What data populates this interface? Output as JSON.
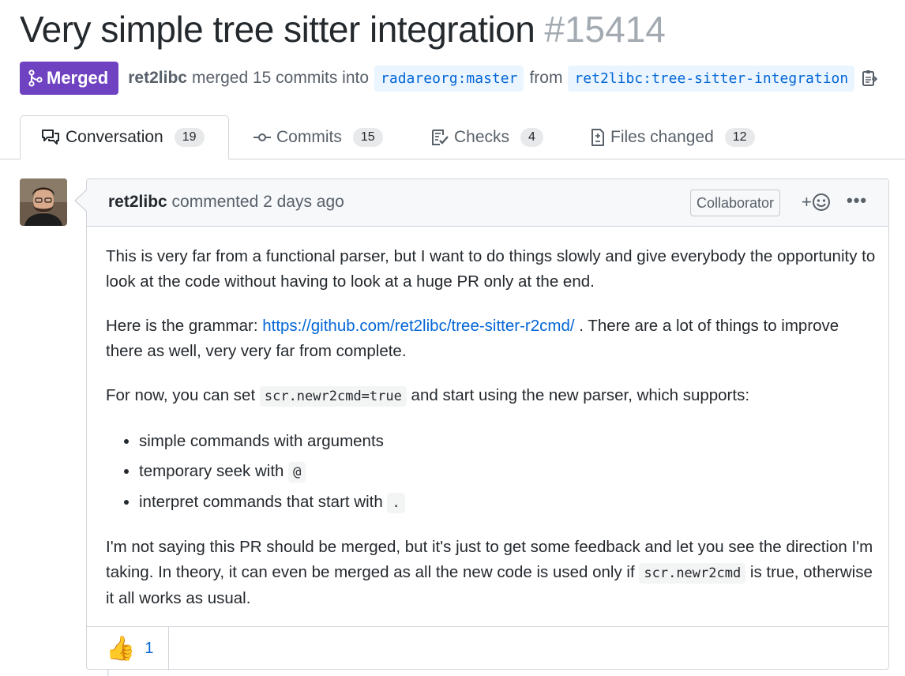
{
  "pr": {
    "title": "Very simple tree sitter integration",
    "number": "#15414",
    "state_label": "Merged",
    "author": "ret2libc",
    "merged_text": "merged 15 commits into",
    "base_branch": "radareorg:master",
    "from_text": "from",
    "head_branch": "ret2libc:tree-sitter-integration"
  },
  "tabs": [
    {
      "label": "Conversation",
      "count": "19",
      "icon": "comment-discussion-icon",
      "active": true
    },
    {
      "label": "Commits",
      "count": "15",
      "icon": "commit-icon"
    },
    {
      "label": "Checks",
      "count": "4",
      "icon": "checklist-icon"
    },
    {
      "label": "Files changed",
      "count": "12",
      "icon": "file-diff-icon"
    }
  ],
  "comment": {
    "author": "ret2libc",
    "action": "commented 2 days ago",
    "role_badge": "Collaborator",
    "add_reaction": "+",
    "menu": "•••",
    "p1": "This is very far from a functional parser, but I want to do things slowly and give everybody the opportunity to look at the code without having to look at a huge PR only at the end.",
    "p2_pre": "Here is the grammar: ",
    "p2_link": "https://github.com/ret2libc/tree-sitter-r2cmd/",
    "p2_post": " . There are a lot of things to improve there as well, very very far from complete.",
    "p3_pre": "For now, you can set ",
    "p3_code": "scr.newr2cmd=true",
    "p3_post": " and start using the new parser, which supports:",
    "list": [
      {
        "text": "simple commands with arguments",
        "code": ""
      },
      {
        "text": "temporary seek with ",
        "code": "@"
      },
      {
        "text": "interpret commands that start with ",
        "code": "."
      }
    ],
    "p4_text": "I'm not saying this PR should be merged, but it's just to get some feedback and let you see the direction I'm taking. In theory, it can even be merged as all the new code is used only if ",
    "p4_code": "scr.newr2cmd",
    "p4_post": " is true, otherwise it all works as usual.",
    "reaction_emoji": "👍",
    "reaction_count": "1"
  },
  "colors": {
    "merged": "#6f42c1",
    "link": "#0366d6",
    "branch_bg": "#eaf5ff"
  }
}
